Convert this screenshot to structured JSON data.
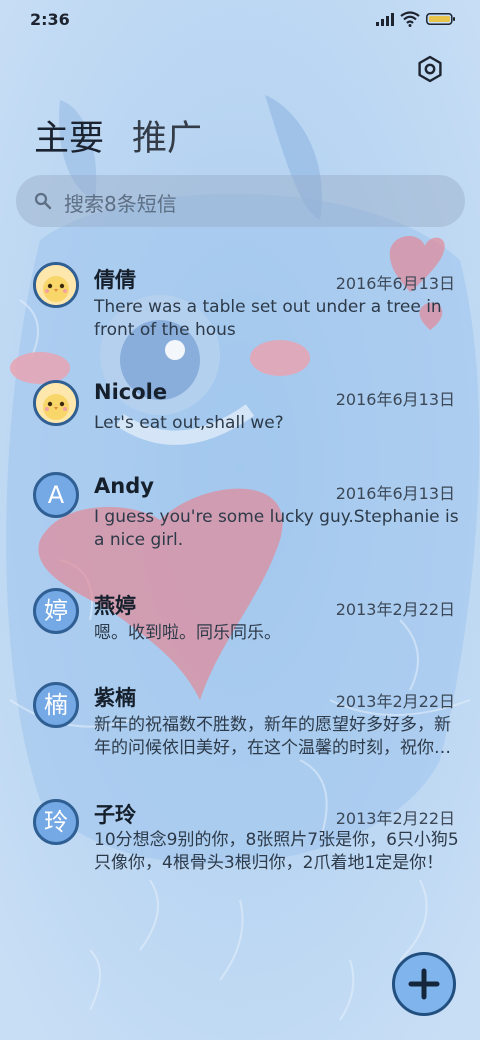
{
  "status_bar": {
    "time": "2:36"
  },
  "tabs": [
    {
      "label": "主要"
    },
    {
      "label": "推广"
    }
  ],
  "search": {
    "placeholder": "搜索8条短信"
  },
  "conversations": [
    {
      "name": "倩倩",
      "date": "2016年6月13日",
      "preview": "There was a table set out under a tree in front of the hous",
      "avatar": "chick-sticker"
    },
    {
      "name": "Nicole",
      "date": "2016年6月13日",
      "preview": "Let's eat out,shall we?",
      "avatar": "chick-sticker"
    },
    {
      "name": "Andy",
      "date": "2016年6月13日",
      "preview": "I guess you're some lucky guy.Stephanie is a nice girl.",
      "avatar_letter": "A"
    },
    {
      "name": "燕婷",
      "date": "2013年2月22日",
      "preview": "嗯。收到啦。同乐同乐。",
      "avatar_letter": "婷"
    },
    {
      "name": "紫楠",
      "date": "2013年2月22日",
      "preview": "新年的祝福数不胜数，新年的愿望好多好多，新年的问候依旧美好，在这个温馨的时刻，祝你新年快乐，万事如意！",
      "avatar_letter": "楠"
    },
    {
      "name": "子玲",
      "date": "2013年2月22日",
      "preview": "10分想念9别的你，8张照片7张是你，6只小狗5只像你，4根骨头3根归你，2爪着地1定是你！",
      "avatar_letter": "玲"
    }
  ],
  "colors": {
    "background": "#bcd6f2",
    "accent": "#74a9e6",
    "border": "#2f5f93"
  },
  "icons": {
    "settings": "settings-icon",
    "search": "search-icon",
    "compose": "plus-icon"
  }
}
